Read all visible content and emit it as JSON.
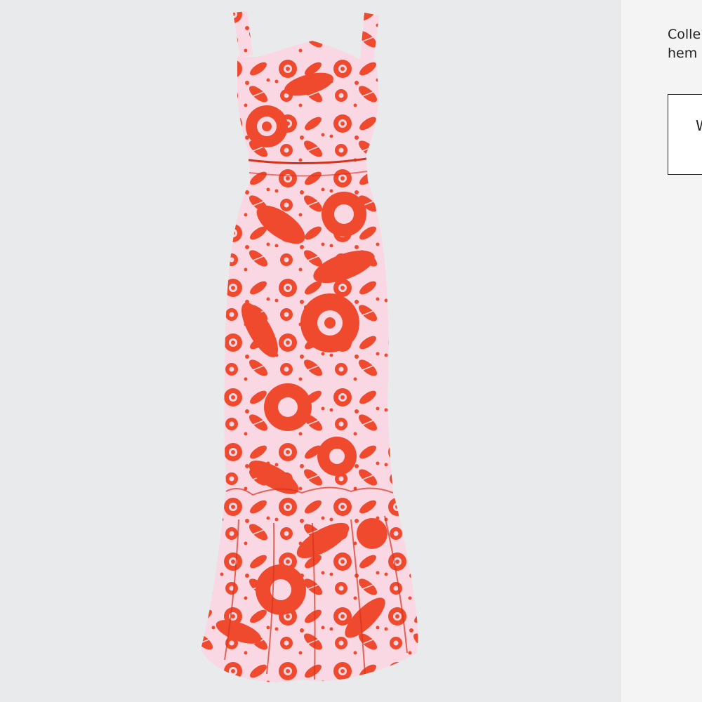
{
  "description": {
    "line1": "Colle",
    "line2": "hem"
  },
  "action": {
    "label": "W"
  },
  "photo": {
    "subject": "dress-icon",
    "colors": {
      "background": "#e9eaec",
      "fabric": "#f9d8e4",
      "print": "#ef4a2e",
      "print_dark": "#d8321c"
    }
  }
}
